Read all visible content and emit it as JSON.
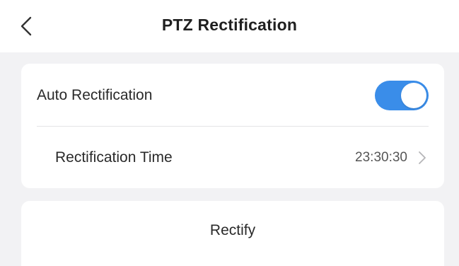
{
  "header": {
    "title": "PTZ Rectification",
    "back_icon": "chevron-left-icon"
  },
  "settings": {
    "auto_rectification": {
      "label": "Auto Rectification",
      "enabled": true
    },
    "rectification_time": {
      "label": "Rectification Time",
      "value": "23:30:30",
      "chevron_icon": "chevron-right-icon"
    }
  },
  "actions": {
    "rectify_label": "Rectify"
  },
  "colors": {
    "accent": "#3a8de9",
    "background": "#f2f2f4",
    "card": "#ffffff"
  }
}
